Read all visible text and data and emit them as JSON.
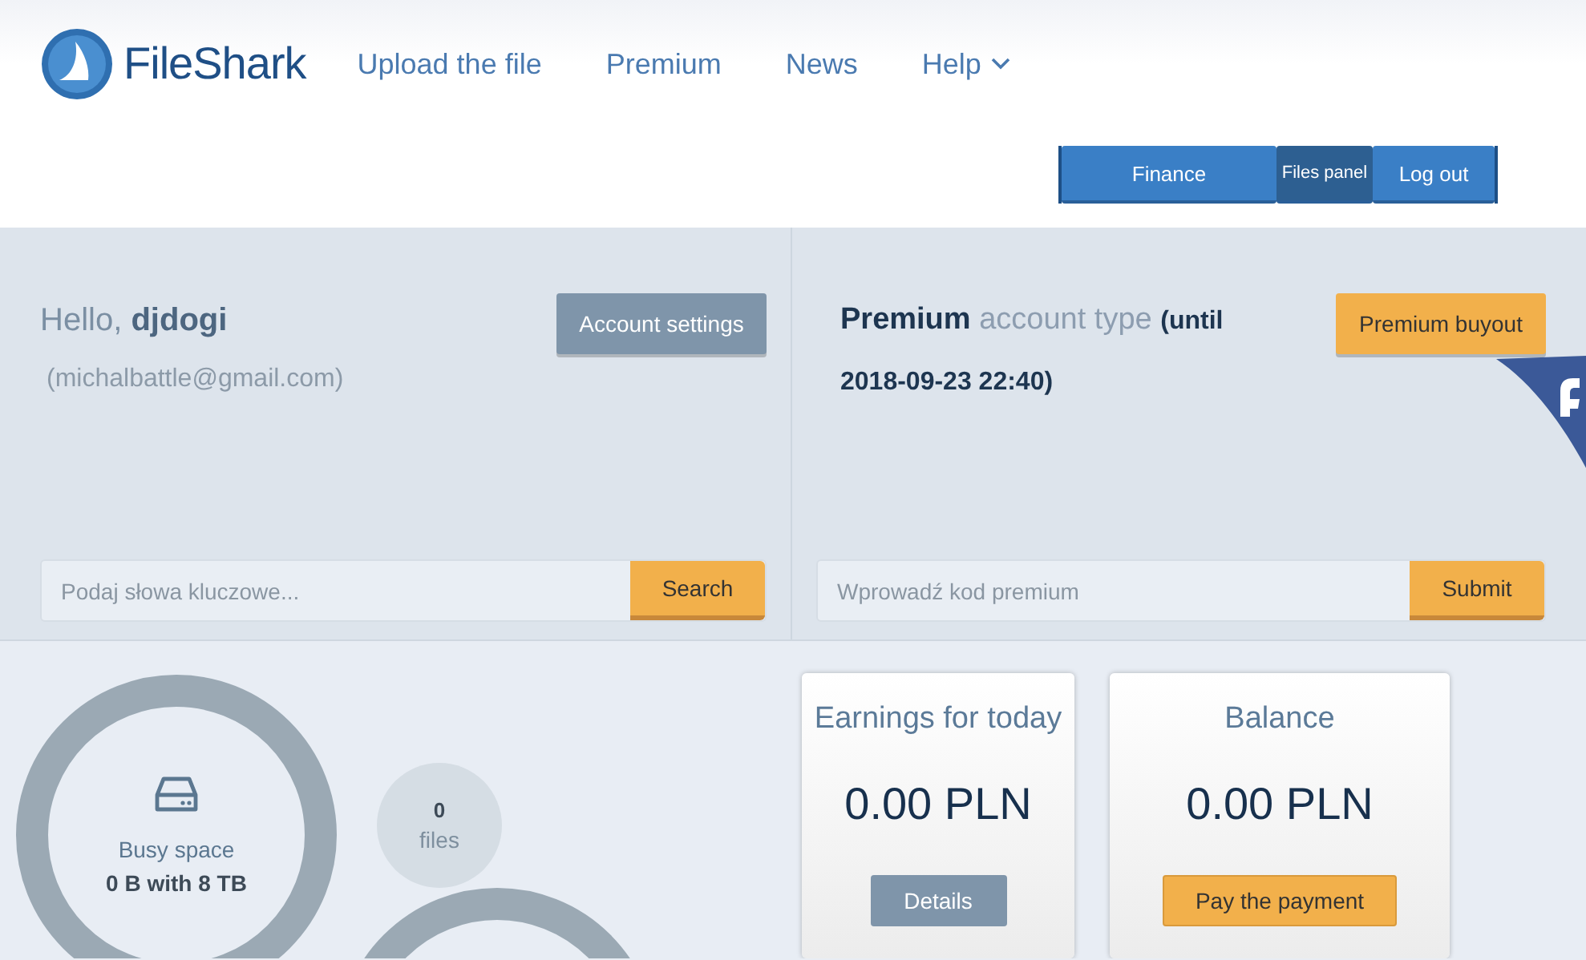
{
  "header": {
    "logo": "FileShark",
    "nav": [
      {
        "label": "Upload the file",
        "dropdown": false
      },
      {
        "label": "Premium",
        "dropdown": false
      },
      {
        "label": "News",
        "dropdown": false
      },
      {
        "label": "Help",
        "dropdown": true
      }
    ],
    "account_buttons": [
      "Finance",
      "Files panel",
      "Log out"
    ]
  },
  "account": {
    "greeting": "Hello, **djdogi**",
    "email": "(michalbattle@gmail.com)",
    "settings_button": "Account settings"
  },
  "premium": {
    "status": "**Premium** account type **(until 2018-09-23 22:40)**",
    "buyout_button": "Premium buyout"
  },
  "search": {
    "placeholder": "Podaj słowa kluczowe...",
    "button": "Search"
  },
  "premium_code": {
    "placeholder": "Wprowadź kod premium",
    "button": "Submit"
  },
  "storage": {
    "label": "Busy space",
    "value": "0 B with 8 TB"
  },
  "files": {
    "count": "0",
    "label": "files"
  },
  "cards": [
    {
      "title": "Earnings for today",
      "amount": "0.00 PLN",
      "button": "Details",
      "kind": "gray"
    },
    {
      "title": "Balance",
      "amount": "0.00 PLN",
      "button": "Pay the payment",
      "kind": "orange"
    }
  ]
}
